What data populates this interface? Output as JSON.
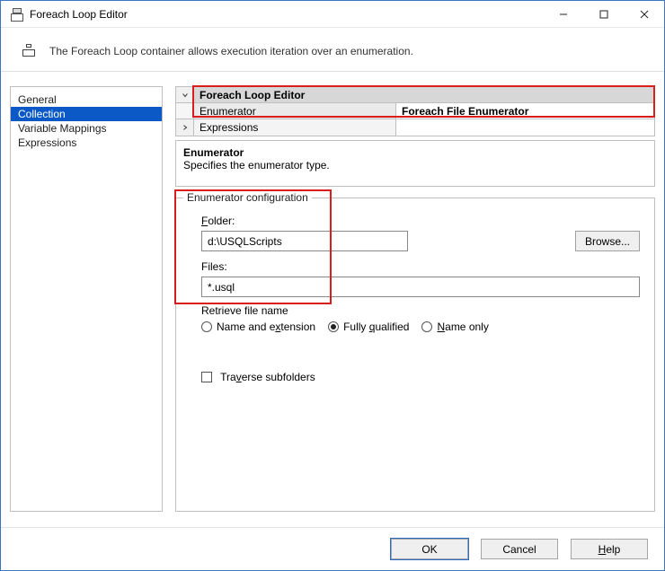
{
  "window": {
    "title": "Foreach Loop Editor"
  },
  "instruction": "The Foreach Loop container allows execution iteration over an enumeration.",
  "sidebar": {
    "items": [
      {
        "label": "General"
      },
      {
        "label": "Collection"
      },
      {
        "label": "Variable Mappings"
      },
      {
        "label": "Expressions"
      }
    ]
  },
  "propgrid": {
    "header": "Foreach Loop Editor",
    "rows": [
      {
        "name": "Enumerator",
        "value": "Foreach File Enumerator"
      },
      {
        "name": "Expressions",
        "value": ""
      }
    ]
  },
  "propdesc": {
    "heading": "Enumerator",
    "text": "Specifies the enumerator type."
  },
  "config": {
    "legend": "Enumerator configuration",
    "folder_label": {
      "pre": "F",
      "post": "older:"
    },
    "folder_value": "d:\\USQLScripts",
    "browse_label": "Browse...",
    "files_label": {
      "pre": "F",
      "post": "iles:"
    },
    "files_value": "*.usql",
    "retrieve_label": "Retrieve file name",
    "radios": {
      "name_ext": {
        "pre": "Name and e",
        "under": "x",
        "post": "tension"
      },
      "fully": {
        "pre": "Fully ",
        "under": "q",
        "post": "ualified"
      },
      "nameonly": {
        "under": "N",
        "post": "ame only"
      }
    },
    "traverse": {
      "pre": "Tra",
      "under": "v",
      "post": "erse subfolders"
    }
  },
  "footer": {
    "ok": "OK",
    "cancel": "Cancel",
    "help": {
      "under": "H",
      "post": "elp"
    }
  }
}
